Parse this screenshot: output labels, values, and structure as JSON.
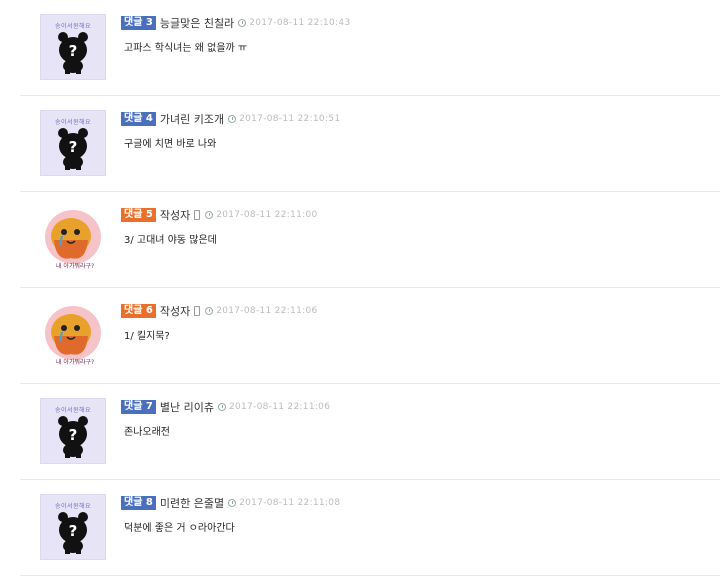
{
  "default_avatar_caption": "송이서윈해요",
  "author_sticker_text": "내 아가뭐라구?",
  "comments": [
    {
      "badge": "댓글 3",
      "badge_color": "blue",
      "nick": "능글맞은 친칠라",
      "time": "2017-08-11 22:10:43",
      "text": "고파스 학식녀는 왜 없을까 ㅠ",
      "avatar": "default",
      "mobile": false
    },
    {
      "badge": "댓글 4",
      "badge_color": "blue",
      "nick": "가녀린 키조개",
      "time": "2017-08-11 22:10:51",
      "text": "구글에 치면 바로 나와",
      "avatar": "default",
      "mobile": false
    },
    {
      "badge": "댓글 5",
      "badge_color": "orange",
      "nick": "작성자",
      "time": "2017-08-11 22:11:00",
      "text": "3/ 고대녀 야동 많은데",
      "avatar": "author",
      "mobile": true
    },
    {
      "badge": "댓글 6",
      "badge_color": "orange",
      "nick": "작성자",
      "time": "2017-08-11 22:11:06",
      "text": "1/ 킬지묵?",
      "avatar": "author",
      "mobile": true
    },
    {
      "badge": "댓글 7",
      "badge_color": "blue",
      "nick": "별난 리이츄",
      "time": "2017-08-11 22:11:06",
      "text": "존나오래전",
      "avatar": "default",
      "mobile": false
    },
    {
      "badge": "댓글 8",
      "badge_color": "blue",
      "nick": "미련한 은줄멸",
      "time": "2017-08-11 22:11:08",
      "text": "덕분에 좋은 거 ㅇ라아간다",
      "avatar": "default",
      "mobile": false
    }
  ],
  "colors": {
    "badge_blue": "#4b6fbf",
    "badge_orange": "#e8702a",
    "avatar_bg": "#e6e4f6"
  }
}
